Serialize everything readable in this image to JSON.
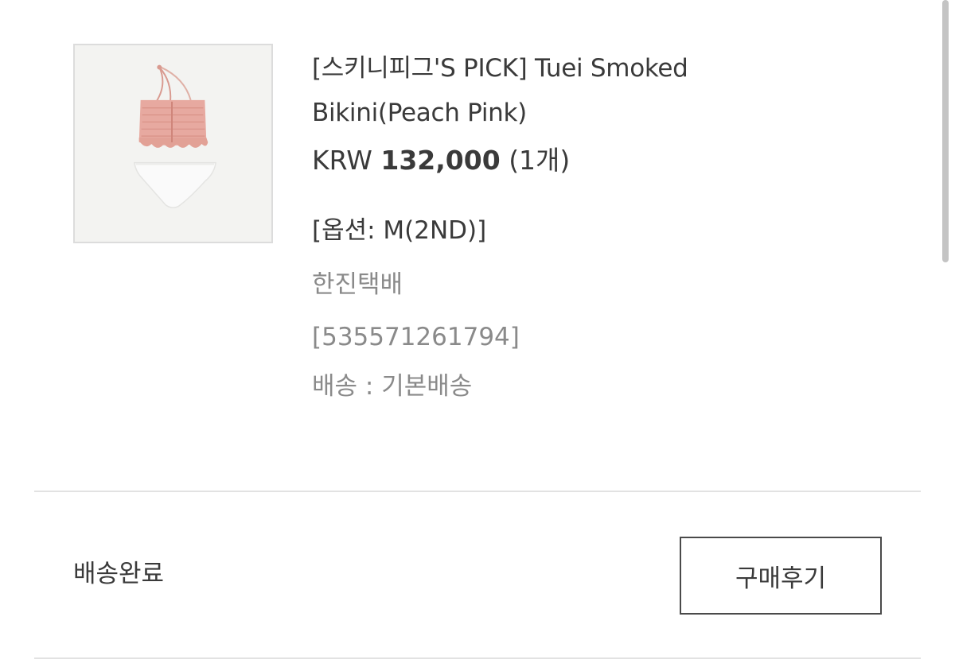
{
  "product": {
    "image_icon": "bikini-product-image",
    "title_line1": "[스키니피그'S PICK] Tuei Smoked",
    "title_line2": "Bikini(Peach Pink)",
    "currency": "KRW",
    "amount": "132,000",
    "quantity": "(1개)",
    "option": "[옵션: M(2ND)]",
    "courier": "한진택배",
    "tracking_number": "[535571261794]",
    "shipping": "배송 : 기본배송"
  },
  "order": {
    "status": "배송완료",
    "review_button_label": "구매후기"
  },
  "colors": {
    "top_fabric": "#e7a9a0",
    "bottom_fabric": "#f7f7f5",
    "text_primary": "#3a3a3a",
    "text_secondary": "#8a8a8a"
  }
}
